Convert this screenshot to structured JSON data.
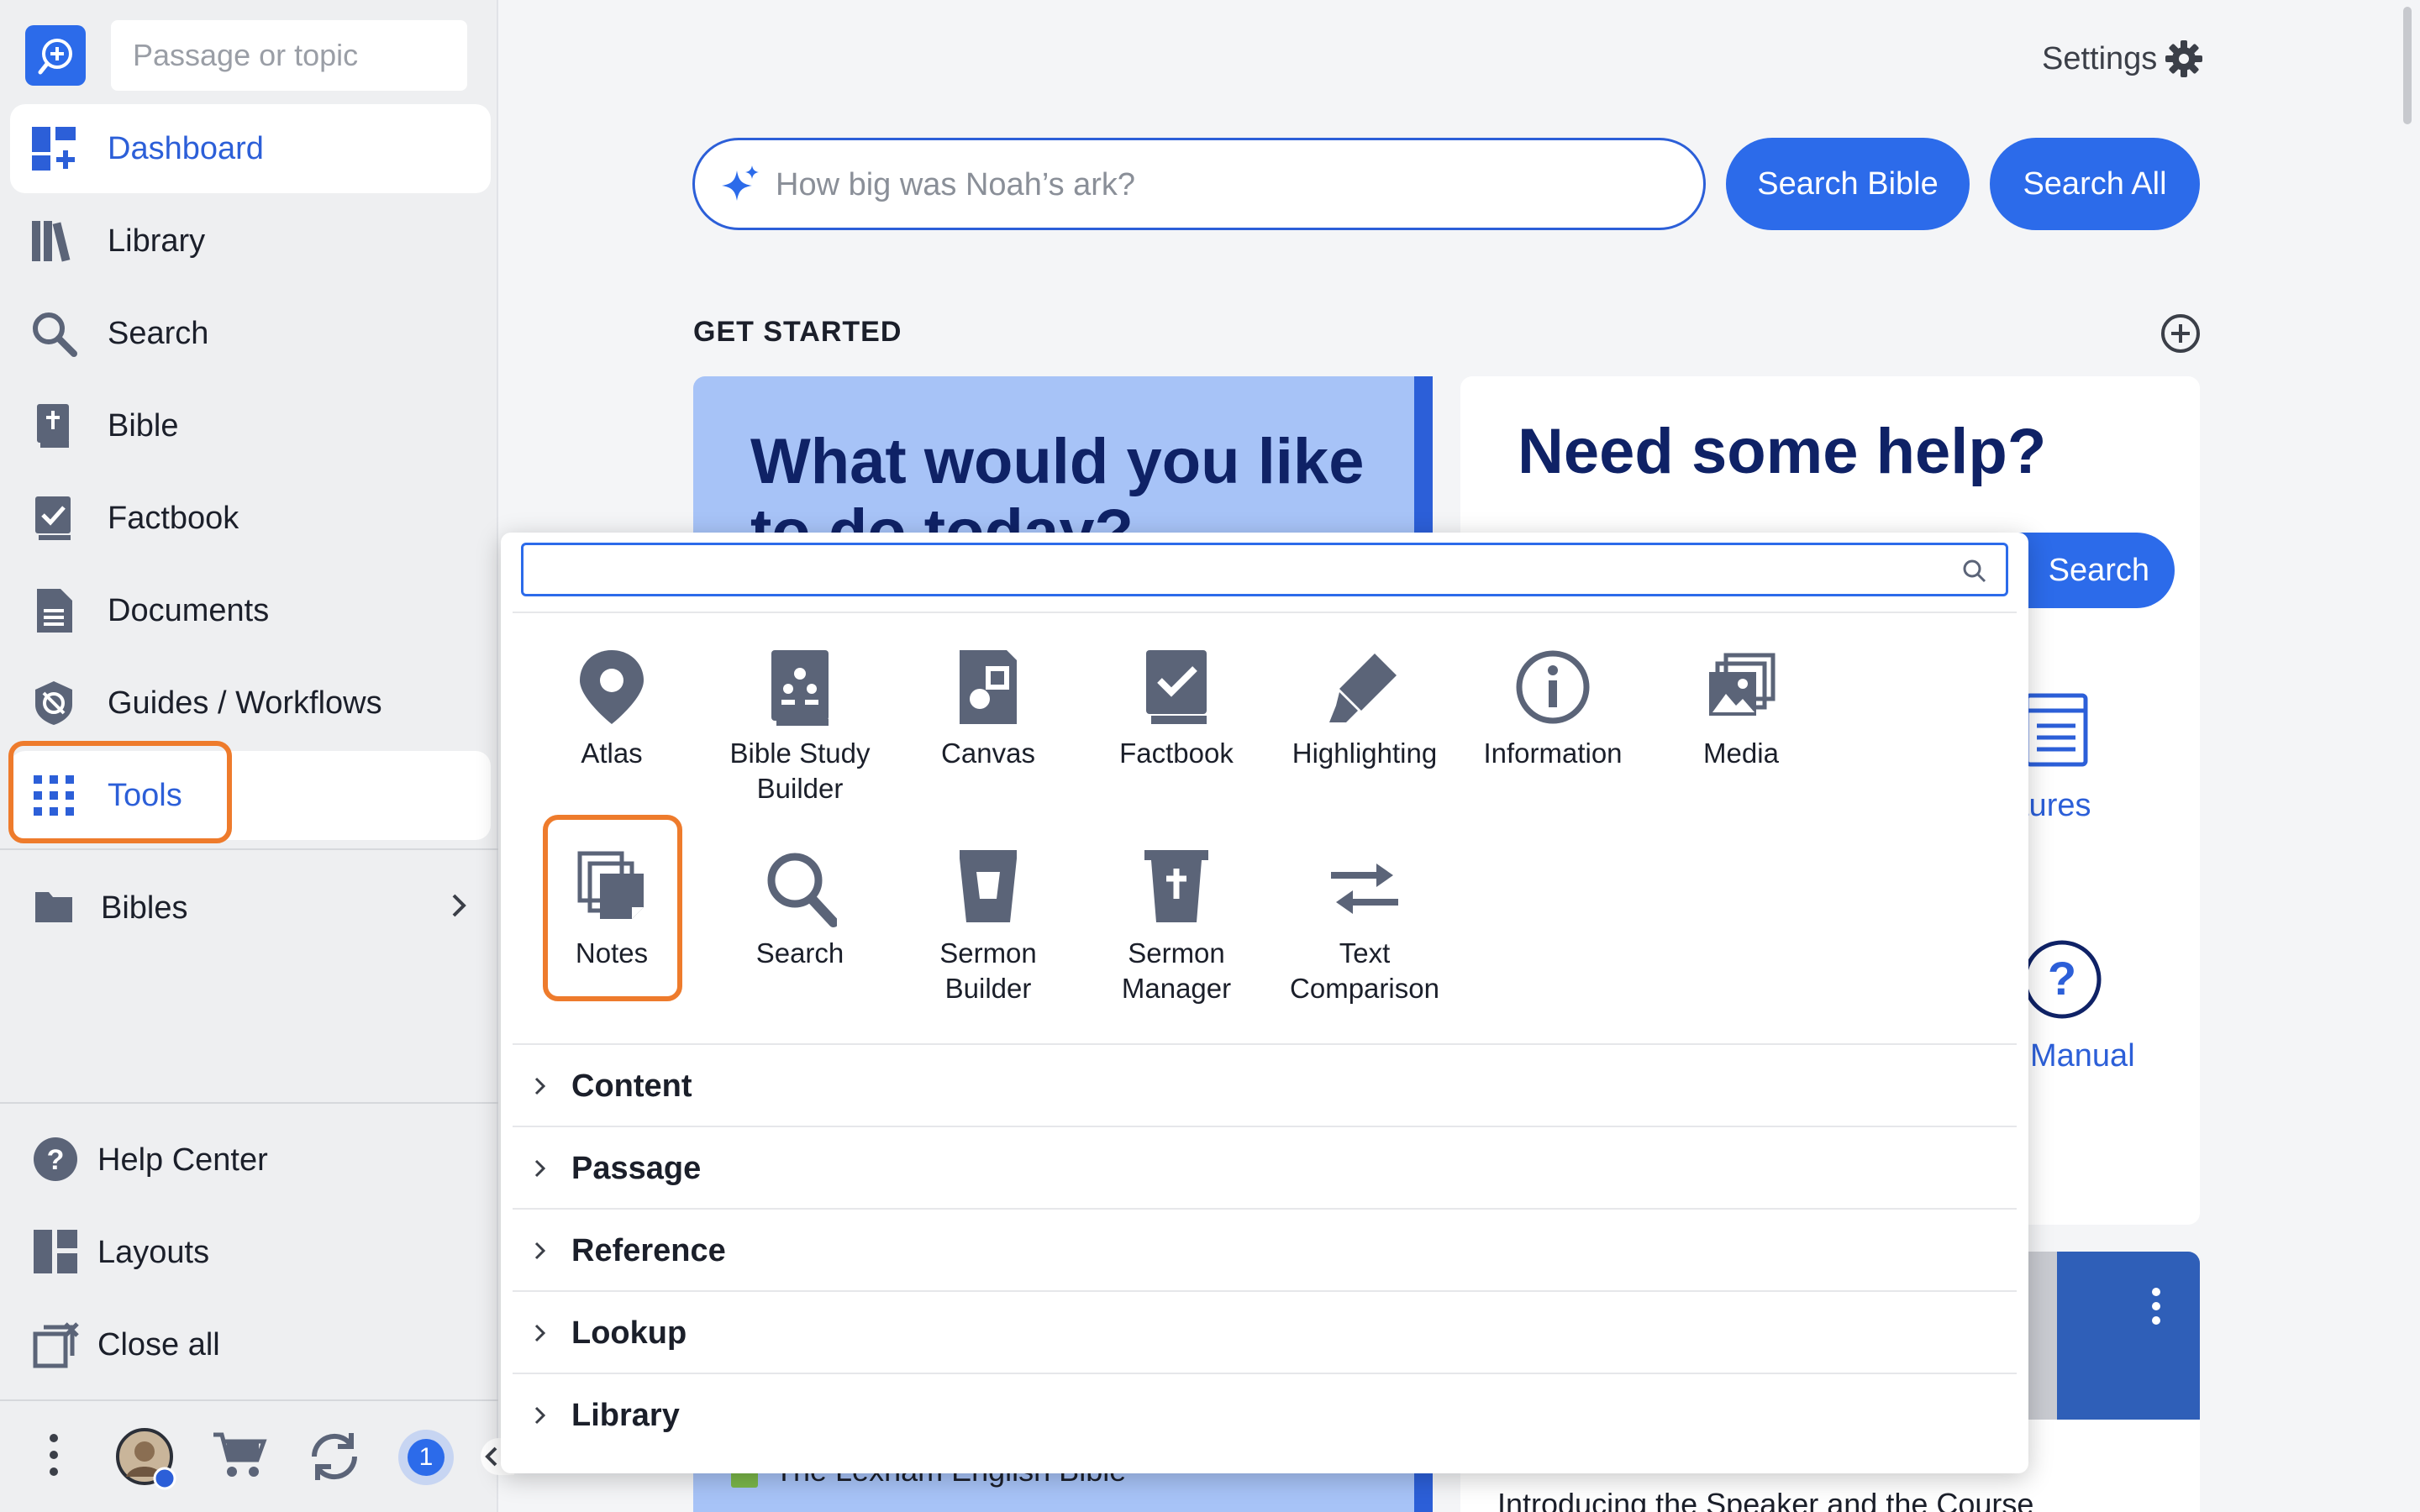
{
  "sidebar": {
    "passage_placeholder": "Passage or topic",
    "items": [
      {
        "label": "Dashboard"
      },
      {
        "label": "Library"
      },
      {
        "label": "Search"
      },
      {
        "label": "Bible"
      },
      {
        "label": "Factbook"
      },
      {
        "label": "Documents"
      },
      {
        "label": "Guides / Workflows"
      },
      {
        "label": "Tools"
      }
    ],
    "bibles_label": "Bibles",
    "footer": [
      {
        "label": "Help Center"
      },
      {
        "label": "Layouts"
      },
      {
        "label": "Close all"
      }
    ],
    "notification_count": "1"
  },
  "header": {
    "settings_label": "Settings",
    "ask_placeholder": "How big was Noah’s ark?",
    "search_bible_label": "Search Bible",
    "search_all_label": "Search All"
  },
  "dashboard": {
    "section_title": "GET STARTED",
    "card_left_title": "What would you like to do today?",
    "card_right_title": "Need some help?",
    "help_search_label": "Search",
    "features_label": "tures",
    "manual_label": "Manual",
    "video_title": "Introducing the Speaker and the Course",
    "lexham_label": "The Lexham English Bible"
  },
  "tools_popup": {
    "search_value": "",
    "tools": [
      {
        "label": "Atlas"
      },
      {
        "label": "Bible Study Builder"
      },
      {
        "label": "Canvas"
      },
      {
        "label": "Factbook"
      },
      {
        "label": "Highlighting"
      },
      {
        "label": "Information"
      },
      {
        "label": "Media"
      },
      {
        "label": "Notes"
      },
      {
        "label": "Search"
      },
      {
        "label": "Sermon Builder"
      },
      {
        "label": "Sermon Manager"
      },
      {
        "label": "Text Comparison"
      }
    ],
    "sections": [
      {
        "label": "Content"
      },
      {
        "label": "Passage"
      },
      {
        "label": "Reference"
      },
      {
        "label": "Lookup"
      },
      {
        "label": "Library"
      }
    ]
  },
  "colors": {
    "accent": "#2c6bea",
    "highlight_outline": "#ee7b2c",
    "nav_icon": "#5b6478",
    "card_blue": "#a7c3f7",
    "title_navy": "#0f2266"
  }
}
